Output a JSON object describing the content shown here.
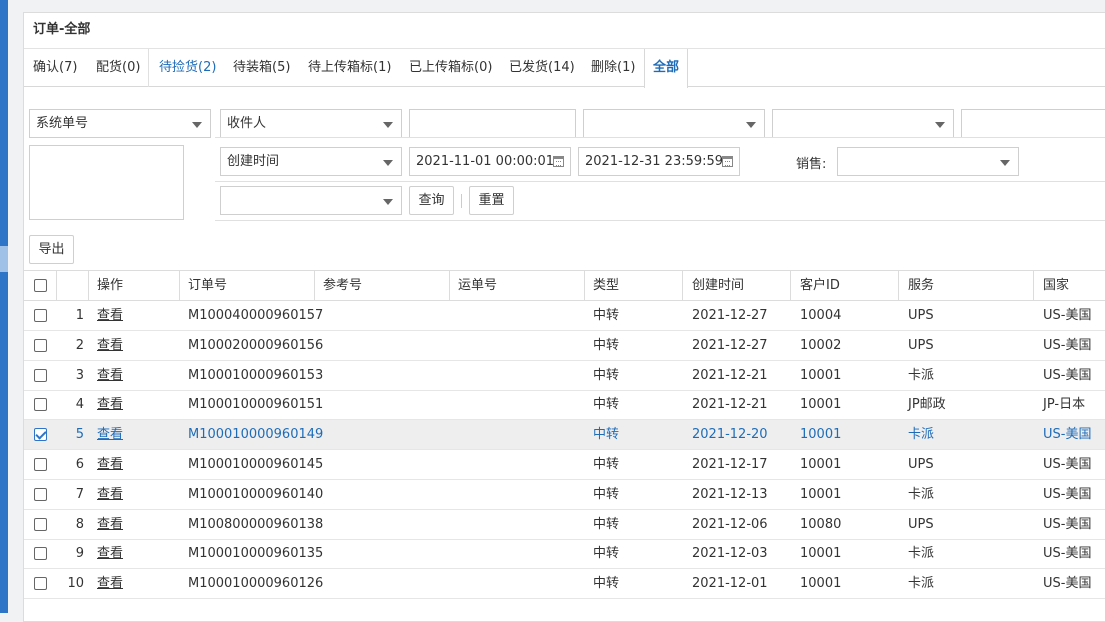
{
  "panel": {
    "title": "订单-全部"
  },
  "tabs": [
    {
      "label": "确认(7)"
    },
    {
      "label": "配货(0)"
    },
    {
      "label": "待捡货(2)"
    },
    {
      "label": "待装箱(5)"
    },
    {
      "label": "待上传箱标(1)"
    },
    {
      "label": "已上传箱标(0)"
    },
    {
      "label": "已发货(14)"
    },
    {
      "label": "删除(1)"
    },
    {
      "label": "全部"
    }
  ],
  "filters": {
    "search_type": "系统单号",
    "recipient_type": "收件人",
    "recipient_value": "",
    "select3": "",
    "select4": "",
    "input5": "",
    "textarea": "",
    "date_type": "创建时间",
    "date_start": "2021-11-01 00:00:01",
    "date_end": "2021-12-31 23:59:59",
    "sales_label": "销售:",
    "sales_value": "",
    "select_extra": "",
    "query_button": "查询",
    "reset_button": "重置",
    "export_button": "导出"
  },
  "table": {
    "columns": [
      "操作",
      "订单号",
      "参考号",
      "运单号",
      "类型",
      "创建时间",
      "客户ID",
      "服务",
      "国家"
    ],
    "rows": [
      {
        "no": "1",
        "action": "查看",
        "order": "M100040000960157",
        "ref": "",
        "waybill": "",
        "type": "中转",
        "created": "2021-12-27",
        "customer": "10004",
        "service": "UPS",
        "country": "US-美国",
        "checked": false
      },
      {
        "no": "2",
        "action": "查看",
        "order": "M100020000960156",
        "ref": "",
        "waybill": "",
        "type": "中转",
        "created": "2021-12-27",
        "customer": "10002",
        "service": "UPS",
        "country": "US-美国",
        "checked": false
      },
      {
        "no": "3",
        "action": "查看",
        "order": "M100010000960153",
        "ref": "",
        "waybill": "",
        "type": "中转",
        "created": "2021-12-21",
        "customer": "10001",
        "service": "卡派",
        "country": "US-美国",
        "checked": false
      },
      {
        "no": "4",
        "action": "查看",
        "order": "M100010000960151",
        "ref": "",
        "waybill": "",
        "type": "中转",
        "created": "2021-12-21",
        "customer": "10001",
        "service": "JP邮政",
        "country": "JP-日本",
        "checked": false
      },
      {
        "no": "5",
        "action": "查看",
        "order": "M100010000960149",
        "ref": "",
        "waybill": "",
        "type": "中转",
        "created": "2021-12-20",
        "customer": "10001",
        "service": "卡派",
        "country": "US-美国",
        "checked": true
      },
      {
        "no": "6",
        "action": "查看",
        "order": "M100010000960145",
        "ref": "",
        "waybill": "",
        "type": "中转",
        "created": "2021-12-17",
        "customer": "10001",
        "service": "UPS",
        "country": "US-美国",
        "checked": false
      },
      {
        "no": "7",
        "action": "查看",
        "order": "M100010000960140",
        "ref": "",
        "waybill": "",
        "type": "中转",
        "created": "2021-12-13",
        "customer": "10001",
        "service": "卡派",
        "country": "US-美国",
        "checked": false
      },
      {
        "no": "8",
        "action": "查看",
        "order": "M100800000960138",
        "ref": "",
        "waybill": "",
        "type": "中转",
        "created": "2021-12-06",
        "customer": "10080",
        "service": "UPS",
        "country": "US-美国",
        "checked": false
      },
      {
        "no": "9",
        "action": "查看",
        "order": "M100010000960135",
        "ref": "",
        "waybill": "",
        "type": "中转",
        "created": "2021-12-03",
        "customer": "10001",
        "service": "卡派",
        "country": "US-美国",
        "checked": false
      },
      {
        "no": "10",
        "action": "查看",
        "order": "M100010000960126",
        "ref": "",
        "waybill": "",
        "type": "中转",
        "created": "2021-12-01",
        "customer": "10001",
        "service": "卡派",
        "country": "US-美国",
        "checked": false
      }
    ]
  },
  "colors": {
    "accent": "#1e6cb8",
    "sidebar": "#2f75c7",
    "selected_row": "#eeeeee"
  }
}
